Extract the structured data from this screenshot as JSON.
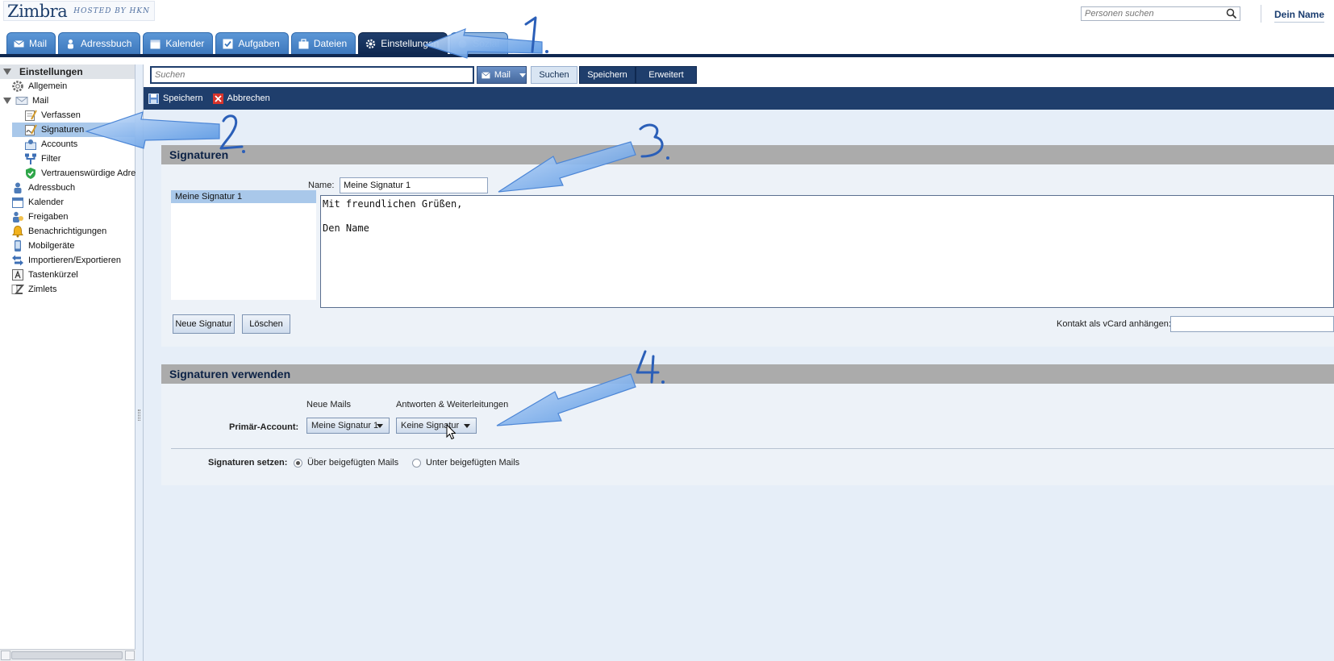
{
  "header": {
    "logo_text": "Zimbra",
    "logo_subtext": "HOSTED BY HKN",
    "people_search_placeholder": "Personen suchen",
    "username": "Dein Name"
  },
  "tabs": [
    {
      "label": "Mail",
      "icon": "mail-icon"
    },
    {
      "label": "Adressbuch",
      "icon": "contacts-icon"
    },
    {
      "label": "Kalender",
      "icon": "calendar-icon"
    },
    {
      "label": "Aufgaben",
      "icon": "tasks-icon"
    },
    {
      "label": "Dateien",
      "icon": "briefcase-icon"
    },
    {
      "label": "Einstellungen",
      "icon": "gear-icon",
      "active": true
    },
    {
      "label": "Sozial",
      "icon": "social-icon"
    }
  ],
  "sidebar": {
    "header": "Einstellungen",
    "items": [
      {
        "label": "Allgemein",
        "icon": "gear-icon"
      },
      {
        "label": "Mail",
        "icon": "mail-icon",
        "expanded": true
      },
      {
        "label": "Verfassen",
        "icon": "compose-icon"
      },
      {
        "label": "Signaturen",
        "icon": "signature-icon",
        "selected": true
      },
      {
        "label": "Accounts",
        "icon": "accounts-icon"
      },
      {
        "label": "Filter",
        "icon": "filter-icon"
      },
      {
        "label": "Vertrauenswürdige Adre",
        "icon": "trusted-shield-icon"
      },
      {
        "label": "Adressbuch",
        "icon": "contacts-icon"
      },
      {
        "label": "Kalender",
        "icon": "calendar-icon"
      },
      {
        "label": "Freigaben",
        "icon": "sharing-icon"
      },
      {
        "label": "Benachrichtigungen",
        "icon": "bell-icon"
      },
      {
        "label": "Mobilgeräte",
        "icon": "mobile-icon"
      },
      {
        "label": "Importieren/Exportieren",
        "icon": "import-export-icon"
      },
      {
        "label": "Tastenkürzel",
        "icon": "keyboard-icon"
      },
      {
        "label": "Zimlets",
        "icon": "zimlet-icon"
      }
    ]
  },
  "searchbar": {
    "placeholder": "Suchen",
    "scope": "Mail",
    "search_label": "Suchen",
    "save_label": "Speichern",
    "advanced_label": "Erweitert"
  },
  "toolbar": {
    "save_label": "Speichern",
    "cancel_label": "Abbrechen"
  },
  "signatures": {
    "title": "Signaturen",
    "name_label": "Name:",
    "name_value": "Meine Signatur 1",
    "list": [
      "Meine Signatur 1"
    ],
    "editor_line1": "Mit freundlichen Grüßen,",
    "editor_line2": "",
    "editor_line3": "Den Name",
    "new_label": "Neue Signatur",
    "delete_label": "Löschen",
    "vcard_label": "Kontakt als vCard anhängen:"
  },
  "usage": {
    "title": "Signaturen verwenden",
    "col_new": "Neue Mails",
    "col_reply": "Antworten & Weiterleitungen",
    "primary_label": "Primär-Account:",
    "primary_new_value": "Meine Signatur 1",
    "primary_reply_value": "Keine Signatur",
    "placement_label": "Signaturen setzen:",
    "option_above": "Über beigefügten Mails",
    "option_below": "Unter beigefügten Mails",
    "selected_option": "above"
  },
  "annotations": [
    "1.",
    "2.",
    "3.",
    "4."
  ],
  "colors": {
    "accent_dark": "#1f3e6c",
    "tab_blue": "#3d78bd",
    "selection": "#a9c8ea",
    "section_header": "#ababab",
    "annotation": "#2b5fb8"
  }
}
